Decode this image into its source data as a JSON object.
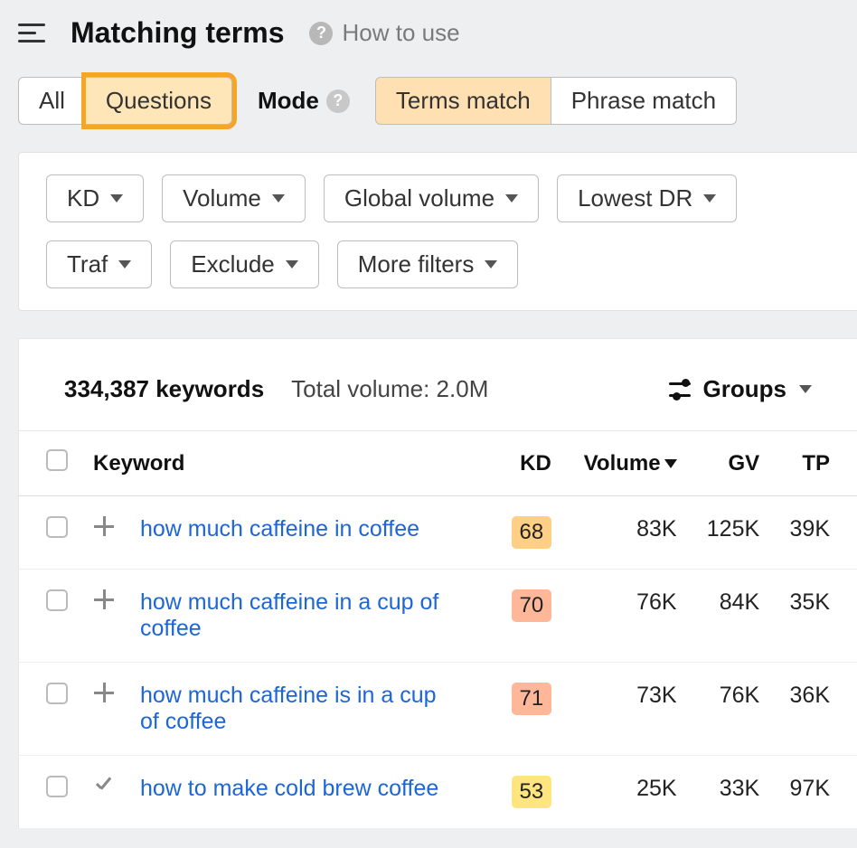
{
  "header": {
    "title": "Matching terms",
    "howToUse": "How to use"
  },
  "tabs": {
    "filter": [
      "All",
      "Questions"
    ],
    "filterActive": 1,
    "modeLabel": "Mode",
    "modes": [
      "Terms match",
      "Phrase match"
    ],
    "modeActive": 0
  },
  "filters": [
    "KD",
    "Volume",
    "Global volume",
    "Lowest DR",
    "Traf",
    "Exclude",
    "More filters"
  ],
  "summary": {
    "keywordCount": "334,387 keywords",
    "totalVolume": "Total volume: 2.0M",
    "groupsLabel": "Groups"
  },
  "columns": {
    "keyword": "Keyword",
    "kd": "KD",
    "volume": "Volume",
    "gv": "GV",
    "tp": "TP"
  },
  "kdColors": {
    "68": "#ffcf86",
    "70": "#ffb79a",
    "71": "#ffb79a",
    "53": "#ffe57f"
  },
  "rows": [
    {
      "action": "plus",
      "keyword": "how much caffeine in coffee",
      "kd": "68",
      "volume": "83K",
      "gv": "125K",
      "tp": "39K"
    },
    {
      "action": "plus",
      "keyword": "how much caffeine in a cup of coffee",
      "kd": "70",
      "volume": "76K",
      "gv": "84K",
      "tp": "35K"
    },
    {
      "action": "plus",
      "keyword": "how much caffeine is in a cup of coffee",
      "kd": "71",
      "volume": "73K",
      "gv": "76K",
      "tp": "36K"
    },
    {
      "action": "check",
      "keyword": "how to make cold brew coffee",
      "kd": "53",
      "volume": "25K",
      "gv": "33K",
      "tp": "97K"
    }
  ]
}
